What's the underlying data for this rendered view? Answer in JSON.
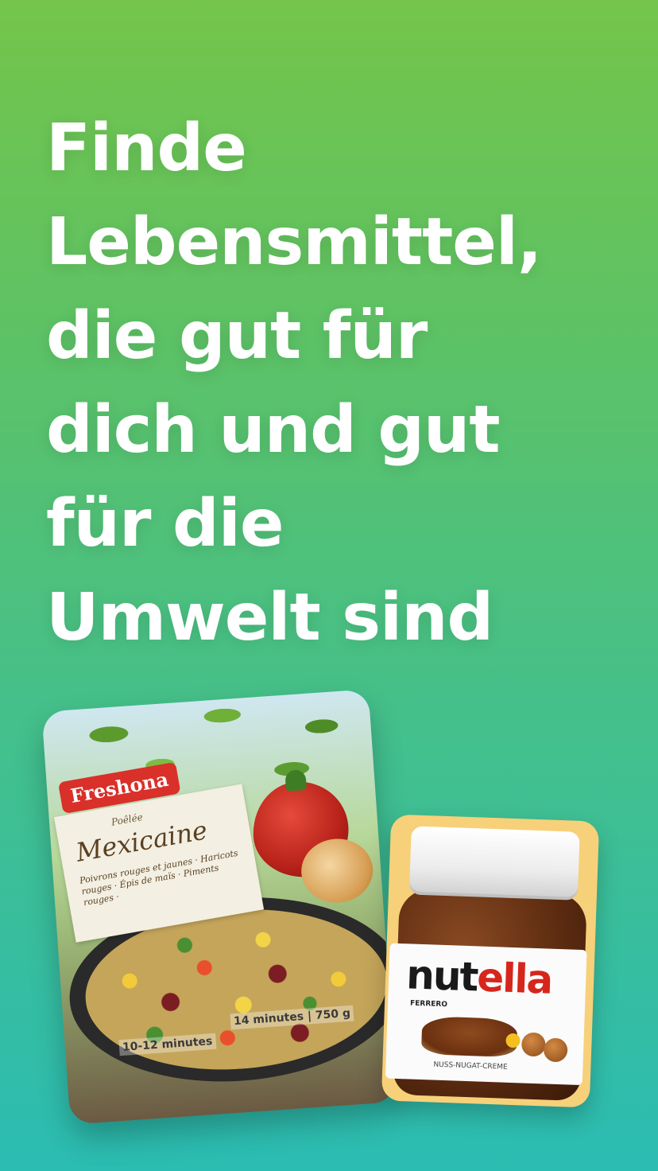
{
  "headline": {
    "lines": [
      "Finde",
      "Lebensmittel,",
      "die gut für",
      "dich und gut",
      "für die",
      "Umwelt sind"
    ]
  },
  "products": {
    "veg": {
      "brand": "Freshona",
      "subtitle": "Poêlée",
      "title": "Mexicaine",
      "description": "Poivrons rouges et jaunes · Haricots rouges · Épis de maïs · Piments rouges ·",
      "info_top": "14 minutes | 750 g",
      "info_bottom": "10-12 minutes"
    },
    "nutella": {
      "brand_black": "nut",
      "brand_red": "ella",
      "maker": "FERRERO",
      "subtitle": "NUSS-NUGAT-CREME"
    }
  },
  "colors": {
    "gradient_top": "#74c54a",
    "gradient_bottom": "#2bbcb2",
    "text": "#ffffff"
  }
}
